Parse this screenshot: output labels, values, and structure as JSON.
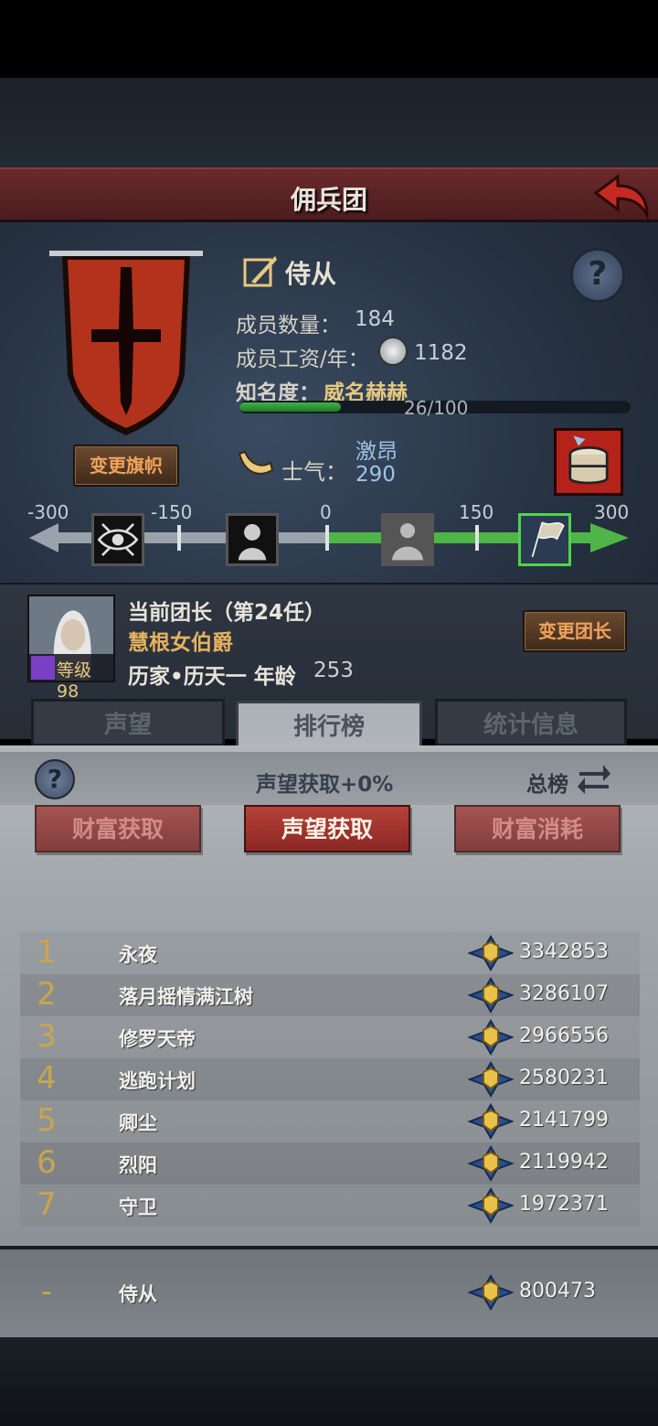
{
  "title": "佣兵团",
  "rank": {
    "name": "侍从"
  },
  "stats": {
    "members_label": "成员数量：",
    "members_value": "184",
    "salary_label": "成员工资/年：",
    "salary_value": "1182",
    "fame_label": "知名度：",
    "fame_value": "威名赫赫",
    "fame_progress": "26/100",
    "fame_fraction": 0.26
  },
  "change_banner_label": "变更旗帜",
  "morale": {
    "label": "士气：",
    "state": "激昂",
    "value": "290",
    "ticks": [
      "-300",
      "-150",
      "0",
      "150",
      "300"
    ]
  },
  "leader": {
    "title": "当前团长（第24任）",
    "name": "慧根女伯爵",
    "level": "等级98",
    "info": "历家•历天一  年龄",
    "age": "253",
    "change_label": "变更团长"
  },
  "tabs": [
    "声望",
    "排行榜",
    "统计信息"
  ],
  "active_tab": 1,
  "sub": {
    "center": "声望获取+0%",
    "right": "总榜"
  },
  "category_buttons": [
    "财富获取",
    "声望获取",
    "财富消耗"
  ],
  "active_category": 1,
  "ranking": [
    {
      "rank": "1",
      "name": "永夜",
      "score": "3342853"
    },
    {
      "rank": "2",
      "name": "落月摇情满江树",
      "score": "3286107"
    },
    {
      "rank": "3",
      "name": "修罗天帝",
      "score": "2966556"
    },
    {
      "rank": "4",
      "name": "逃跑计划",
      "score": "2580231"
    },
    {
      "rank": "5",
      "name": "卿尘",
      "score": "2141799"
    },
    {
      "rank": "6",
      "name": "烈阳",
      "score": "2119942"
    },
    {
      "rank": "7",
      "name": "守卫",
      "score": "1972371"
    }
  ],
  "self_row": {
    "rank": "-",
    "name": "侍从",
    "score": "800473"
  },
  "colors": {
    "accent_gold": "#e6c880",
    "morale_blue": "#9fc3e8",
    "title_red": "#6a2a2c"
  }
}
